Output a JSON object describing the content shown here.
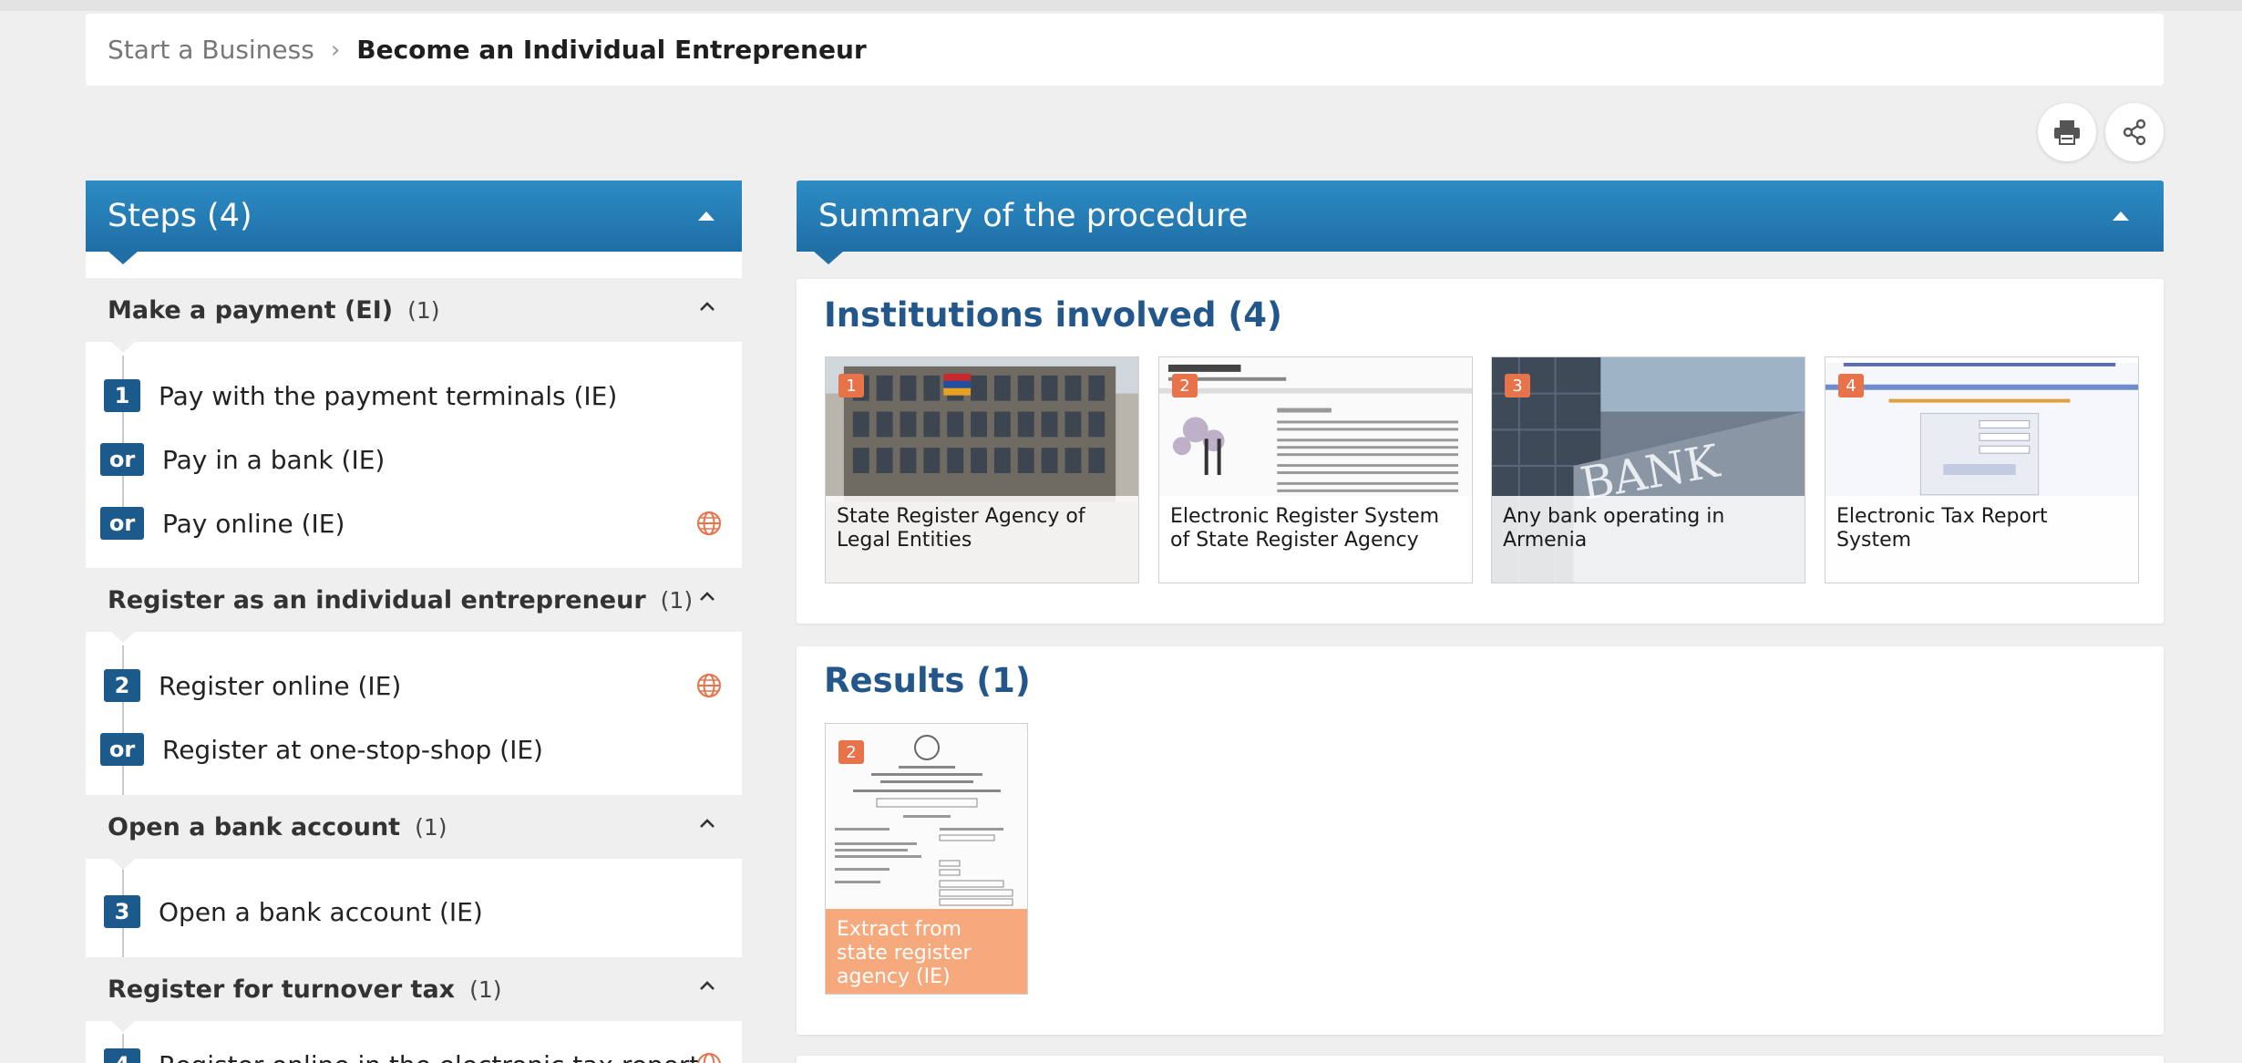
{
  "breadcrumb": {
    "parent": "Start a Business",
    "separator": "›",
    "current": "Become an Individual Entrepreneur"
  },
  "toolbar": {
    "print_icon": "printer-icon",
    "share_icon": "share-icon"
  },
  "steps_panel": {
    "title": "Steps (4)",
    "groups": [
      {
        "name": "Make a payment (EI)",
        "count": "(1)",
        "items": [
          {
            "badge": "1",
            "label": "Pay with the payment terminals (IE)"
          },
          {
            "badge": "or",
            "label": "Pay in a bank (IE)"
          },
          {
            "badge": "or",
            "label": "Pay online (IE)",
            "icon": "globe-icon"
          }
        ]
      },
      {
        "name": "Register as an individual entrepreneur",
        "count": "(1)",
        "items": [
          {
            "badge": "2",
            "label": "Register online (IE)",
            "icon": "globe-icon"
          },
          {
            "badge": "or",
            "label": "Register at one-stop-shop (IE)"
          }
        ]
      },
      {
        "name": "Open a bank account",
        "count": "(1)",
        "items": [
          {
            "badge": "3",
            "label": "Open a bank account (IE)"
          }
        ]
      },
      {
        "name": "Register for turnover tax",
        "count": "(1)",
        "items": [
          {
            "badge": "4",
            "label": "Register online in the electronic tax report",
            "icon": "globe-icon"
          }
        ]
      }
    ]
  },
  "summary_panel": {
    "title": "Summary of the procedure",
    "institutions": {
      "title": "Institutions involved (4)",
      "items": [
        {
          "num": "1",
          "label": "State Register Agency of Legal Entities"
        },
        {
          "num": "2",
          "label": "Electronic Register System of State Register Agency"
        },
        {
          "num": "3",
          "label": "Any bank operating in Armenia"
        },
        {
          "num": "4",
          "label": "Electronic Tax Report System"
        }
      ]
    },
    "results": {
      "title": "Results (1)",
      "items": [
        {
          "num": "2",
          "label": "Extract from state register agency (IE)"
        }
      ]
    }
  },
  "colors": {
    "accent": "#1f6ea6",
    "badge": "#1c5a8c",
    "heading": "#23578c",
    "orange": "#e8734a"
  }
}
